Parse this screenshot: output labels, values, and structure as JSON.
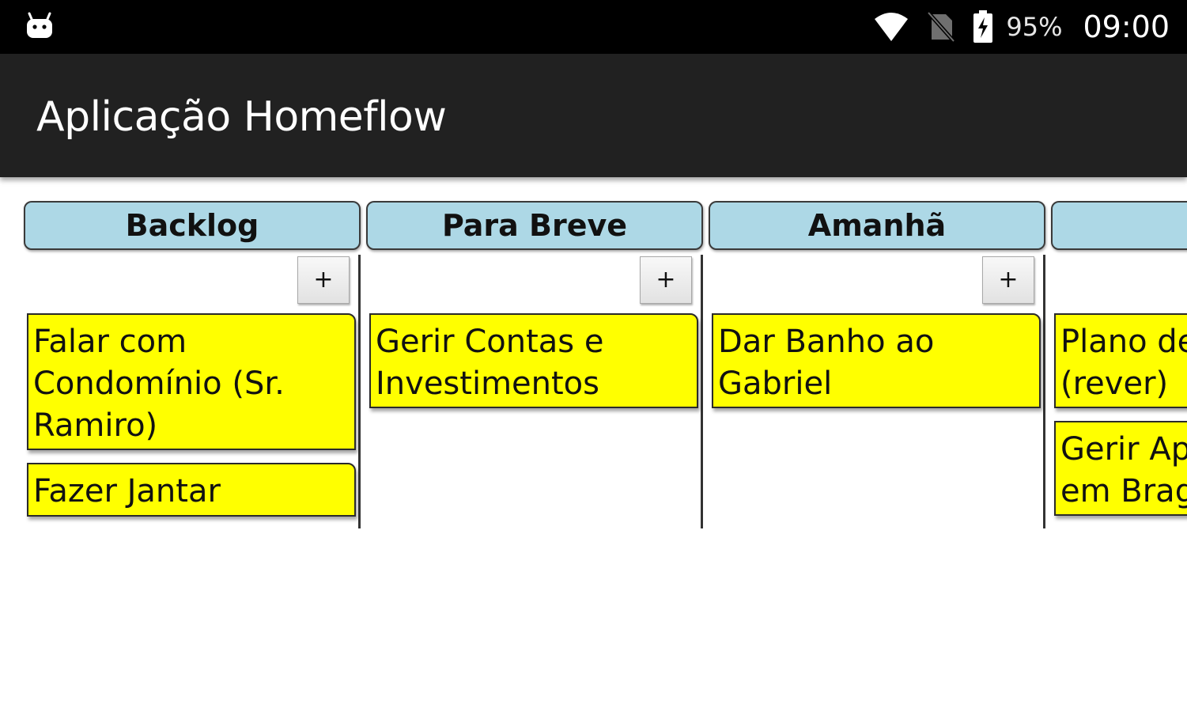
{
  "status_bar": {
    "app_icon": "android-icon",
    "wifi_icon": "wifi-icon",
    "no_sim_icon": "no-sim-icon",
    "battery_icon": "battery-charging-icon",
    "battery": "95%",
    "time": "09:00"
  },
  "app_bar": {
    "title": "Aplicação Homeflow"
  },
  "board": {
    "add_label": "+",
    "columns": [
      {
        "title": "Backlog",
        "cards": [
          {
            "lines": [
              "Falar com",
              "Condomínio (Sr.",
              "Ramiro)"
            ]
          },
          {
            "lines": [
              "Fazer Jantar"
            ]
          }
        ]
      },
      {
        "title": "Para Breve",
        "cards": [
          {
            "lines": [
              "Gerir Contas e",
              "Investimentos"
            ]
          }
        ]
      },
      {
        "title": "Amanhã",
        "cards": [
          {
            "lines": [
              "Dar Banho ao",
              "Gabriel"
            ]
          }
        ]
      },
      {
        "title": "",
        "cards": [
          {
            "lines": [
              "Plano de",
              "(rever)"
            ]
          },
          {
            "lines": [
              "Gerir Ap",
              "em Brag"
            ]
          }
        ]
      }
    ]
  },
  "colors": {
    "status_bar": "#000000",
    "app_bar": "#212121",
    "column_header": "#add8e6",
    "card": "#ffff00"
  }
}
